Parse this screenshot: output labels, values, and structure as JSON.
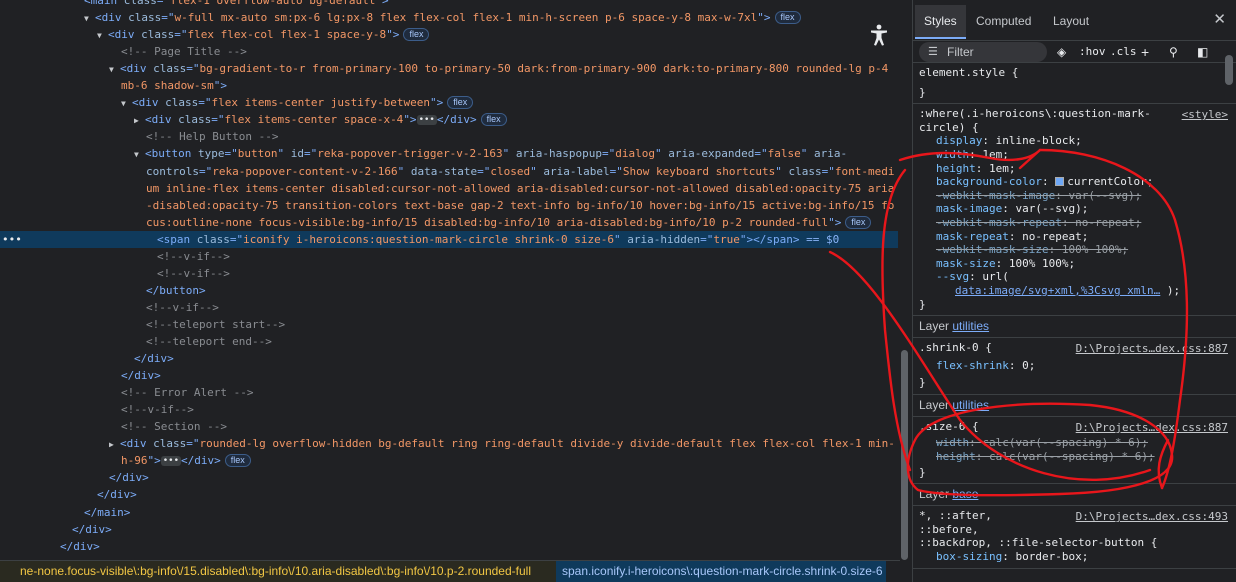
{
  "elements": {
    "lines": [
      {
        "indent": 84,
        "tri": "",
        "parts": [
          [
            "tag",
            "<main "
          ],
          [
            "attr",
            "class"
          ],
          [
            "tag",
            "=\""
          ],
          [
            "aval",
            "flex-1 overflow-auto bg-default"
          ],
          [
            "tag",
            "\">"
          ]
        ]
      },
      {
        "indent": 84,
        "tri": "▼",
        "parts": [
          [
            "tag",
            "<div "
          ],
          [
            "attr",
            "class"
          ],
          [
            "tag",
            "=\""
          ],
          [
            "aval",
            "w-full mx-auto sm:px-6 lg:px-8 flex flex-col flex-1 min-h-screen p-6 space-y-8 max-w-7xl"
          ],
          [
            "tag",
            "\">"
          ]
        ],
        "badge": "flex"
      },
      {
        "indent": 97,
        "tri": "▼",
        "parts": [
          [
            "tag",
            "<div "
          ],
          [
            "attr",
            "class"
          ],
          [
            "tag",
            "=\""
          ],
          [
            "aval",
            "flex flex-col flex-1 space-y-8"
          ],
          [
            "tag",
            "\">"
          ]
        ],
        "badge": "flex"
      },
      {
        "indent": 121,
        "tri": "",
        "parts": [
          [
            "cmt",
            "<!-- Page Title -->"
          ]
        ]
      },
      {
        "indent": 109,
        "tri": "▼",
        "parts": [
          [
            "tag",
            "<div "
          ],
          [
            "attr",
            "class"
          ],
          [
            "tag",
            "=\""
          ],
          [
            "aval",
            "bg-gradient-to-r from-primary-100 to-primary-50 dark:from-primary-900 dark:to-primary-800 rounded-lg p-4"
          ]
        ]
      },
      {
        "indent": 121,
        "tri": "",
        "parts": [
          [
            "aval",
            "mb-6 shadow-sm"
          ],
          [
            "tag",
            "\">"
          ]
        ]
      },
      {
        "indent": 121,
        "tri": "▼",
        "parts": [
          [
            "tag",
            "<div "
          ],
          [
            "attr",
            "class"
          ],
          [
            "tag",
            "=\""
          ],
          [
            "aval",
            "flex items-center justify-between"
          ],
          [
            "tag",
            "\">"
          ]
        ],
        "badge": "flex"
      },
      {
        "indent": 134,
        "tri": "▶",
        "parts": [
          [
            "tag",
            "<div "
          ],
          [
            "attr",
            "class"
          ],
          [
            "tag",
            "=\""
          ],
          [
            "aval",
            "flex items-center space-x-4"
          ],
          [
            "tag",
            "\">"
          ]
        ],
        "ellipsis": true,
        "after": "</div>",
        "badge": "flex"
      },
      {
        "indent": 146,
        "tri": "",
        "parts": [
          [
            "cmt",
            "<!-- Help Button -->"
          ]
        ]
      },
      {
        "indent": 134,
        "tri": "▼",
        "parts": [
          [
            "tag",
            "<button "
          ],
          [
            "attr",
            "type"
          ],
          [
            "tag",
            "=\""
          ],
          [
            "aval",
            "button"
          ],
          [
            "tag",
            "\" "
          ],
          [
            "attr",
            "id"
          ],
          [
            "tag",
            "=\""
          ],
          [
            "aval",
            "reka-popover-trigger-v-2-163"
          ],
          [
            "tag",
            "\" "
          ],
          [
            "attr",
            "aria-haspopup"
          ],
          [
            "tag",
            "=\""
          ],
          [
            "aval",
            "dialog"
          ],
          [
            "tag",
            "\" "
          ],
          [
            "attr",
            "aria-expanded"
          ],
          [
            "tag",
            "=\""
          ],
          [
            "aval",
            "false"
          ],
          [
            "tag",
            "\" "
          ],
          [
            "attr",
            "aria-"
          ]
        ]
      },
      {
        "indent": 146,
        "tri": "",
        "parts": [
          [
            "attr",
            "controls"
          ],
          [
            "tag",
            "=\""
          ],
          [
            "aval",
            "reka-popover-content-v-2-166"
          ],
          [
            "tag",
            "\" "
          ],
          [
            "attr",
            "data-state"
          ],
          [
            "tag",
            "=\""
          ],
          [
            "aval",
            "closed"
          ],
          [
            "tag",
            "\" "
          ],
          [
            "attr",
            "aria-label"
          ],
          [
            "tag",
            "=\""
          ],
          [
            "aval",
            "Show keyboard shortcuts"
          ],
          [
            "tag",
            "\" "
          ],
          [
            "attr",
            "class"
          ],
          [
            "tag",
            "=\""
          ],
          [
            "aval",
            "font-medi"
          ]
        ]
      },
      {
        "indent": 146,
        "tri": "",
        "parts": [
          [
            "aval",
            "um inline-flex items-center disabled:cursor-not-allowed aria-disabled:cursor-not-allowed disabled:opacity-75 aria"
          ]
        ]
      },
      {
        "indent": 146,
        "tri": "",
        "parts": [
          [
            "aval",
            "-disabled:opacity-75 transition-colors text-base gap-2 text-info bg-info/10 hover:bg-info/15 active:bg-info/15 fo"
          ]
        ]
      },
      {
        "indent": 146,
        "tri": "",
        "parts": [
          [
            "aval",
            "cus:outline-none focus-visible:bg-info/15 disabled:bg-info/10 aria-disabled:bg-info/10 p-2 rounded-full"
          ],
          [
            "tag",
            "\">"
          ]
        ],
        "badge": "flex"
      },
      {
        "indent": 157,
        "tri": "",
        "selected": true,
        "parts": [
          [
            "tag",
            "<span "
          ],
          [
            "attr",
            "class"
          ],
          [
            "tag",
            "=\""
          ],
          [
            "aval",
            "iconify i-heroicons:question-mark-circle shrink-0 size-6"
          ],
          [
            "tag",
            "\" "
          ],
          [
            "attr",
            "aria-hidden"
          ],
          [
            "tag",
            "=\""
          ],
          [
            "aval",
            "true"
          ],
          [
            "tag",
            "\"></span>"
          ]
        ],
        "suffix": " == $0"
      },
      {
        "indent": 157,
        "tri": "",
        "parts": [
          [
            "cmt",
            "<!--v-if-->"
          ]
        ]
      },
      {
        "indent": 157,
        "tri": "",
        "parts": [
          [
            "cmt",
            "<!--v-if-->"
          ]
        ]
      },
      {
        "indent": 146,
        "tri": "",
        "parts": [
          [
            "tag",
            "</button>"
          ]
        ]
      },
      {
        "indent": 146,
        "tri": "",
        "parts": [
          [
            "cmt",
            "<!--v-if-->"
          ]
        ]
      },
      {
        "indent": 146,
        "tri": "",
        "parts": [
          [
            "cmt",
            "<!--teleport start-->"
          ]
        ]
      },
      {
        "indent": 146,
        "tri": "",
        "parts": [
          [
            "cmt",
            "<!--teleport end-->"
          ]
        ]
      },
      {
        "indent": 134,
        "tri": "",
        "parts": [
          [
            "tag",
            "</div>"
          ]
        ]
      },
      {
        "indent": 121,
        "tri": "",
        "parts": [
          [
            "tag",
            "</div>"
          ]
        ]
      },
      {
        "indent": 121,
        "tri": "",
        "parts": [
          [
            "cmt",
            "<!-- Error Alert -->"
          ]
        ]
      },
      {
        "indent": 121,
        "tri": "",
        "parts": [
          [
            "cmt",
            "<!--v-if-->"
          ]
        ]
      },
      {
        "indent": 121,
        "tri": "",
        "parts": [
          [
            "cmt",
            "<!-- Section -->"
          ]
        ]
      },
      {
        "indent": 109,
        "tri": "▶",
        "parts": [
          [
            "tag",
            "<div "
          ],
          [
            "attr",
            "class"
          ],
          [
            "tag",
            "=\""
          ],
          [
            "aval",
            "rounded-lg overflow-hidden bg-default ring ring-default divide-y divide-default flex flex-col flex-1 min-"
          ]
        ]
      },
      {
        "indent": 121,
        "tri": "",
        "parts": [
          [
            "aval",
            "h-96"
          ],
          [
            "tag",
            "\">"
          ]
        ],
        "ellipsis": true,
        "after": "</div>",
        "badge": "flex"
      },
      {
        "indent": 109,
        "tri": "",
        "parts": [
          [
            "tag",
            "</div>"
          ]
        ]
      },
      {
        "indent": 97,
        "tri": "",
        "parts": [
          [
            "tag",
            "</div>"
          ]
        ]
      },
      {
        "indent": 84,
        "tri": "",
        "parts": [
          [
            "tag",
            "</main>"
          ]
        ]
      },
      {
        "indent": 72,
        "tri": "",
        "parts": [
          [
            "tag",
            "</div>"
          ]
        ]
      },
      {
        "indent": 60,
        "tri": "",
        "parts": [
          [
            "tag",
            "</div>"
          ]
        ]
      }
    ]
  },
  "breadcrumbs": {
    "left": "ne-none.focus-visible\\:bg-info\\/15.disabled\\:bg-info\\/10.aria-disabled\\:bg-info\\/10.p-2.rounded-full",
    "right": "span.iconify.i-heroicons\\:question-mark-circle.shrink-0.size-6"
  },
  "styles": {
    "tabs": [
      "Styles",
      "Computed",
      "Layout"
    ],
    "filter_placeholder": "Filter",
    "hov": ":hov",
    "cls": ".cls",
    "element_style": "element.style {",
    "close_brace": "}",
    "rule1": {
      "selector_line1": ":where(.i-heroicons\\:question-mark-",
      "selector_line2": "circle) {",
      "source": "<style>",
      "decls": [
        {
          "name": "display",
          "value": "inline-block;",
          "struck": false
        },
        {
          "name": "width",
          "value": "1em;",
          "struck": false
        },
        {
          "name": "height",
          "value": "1em;",
          "struck": false
        },
        {
          "name": "background-color",
          "value": "currentColor;",
          "struck": false,
          "swatch": true
        },
        {
          "name": "-webkit-mask-image",
          "value": "var(--svg);",
          "struck": true
        },
        {
          "name": "mask-image",
          "value": "var(--svg);",
          "struck": false
        },
        {
          "name": "-webkit-mask-repeat",
          "value": "no-repeat;",
          "struck": true
        },
        {
          "name": "mask-repeat",
          "value": "no-repeat;",
          "struck": false
        },
        {
          "name": "-webkit-mask-size",
          "value": "100% 100%;",
          "struck": true
        },
        {
          "name": "mask-size",
          "value": "100% 100%;",
          "struck": false
        },
        {
          "name": "--svg",
          "value": "url(",
          "struck": false
        }
      ],
      "svg_url": "data:image/svg+xml,%3Csvg xmln…",
      "svg_tail": " );"
    },
    "layer_label": "Layer",
    "layer_utilities": "utilities",
    "layer_base": "base",
    "rule2": {
      "selector": ".shrink-0 {",
      "source": "D:\\Projects…dex.css:887",
      "decl_name": "flex-shrink",
      "decl_value": "0;"
    },
    "rule3": {
      "selector": ".size-6 {",
      "source": "D:\\Projects…dex.css:887",
      "decls": [
        {
          "name": "width",
          "value": "calc(var(--spacing) * 6);"
        },
        {
          "name": "height",
          "value": "calc(var(--spacing) * 6);"
        }
      ]
    },
    "rule4": {
      "selector_line1": "*, ::after,",
      "selector_line2": "::before,",
      "selector_line3": "::backdrop, ::file-selector-button {",
      "source": "D:\\Projects…dex.css:493",
      "decl_name": "box-sizing",
      "decl_value": "border-box;"
    }
  },
  "colors": {
    "annotation": "#e8161b",
    "selection": "#0f3a5c"
  }
}
